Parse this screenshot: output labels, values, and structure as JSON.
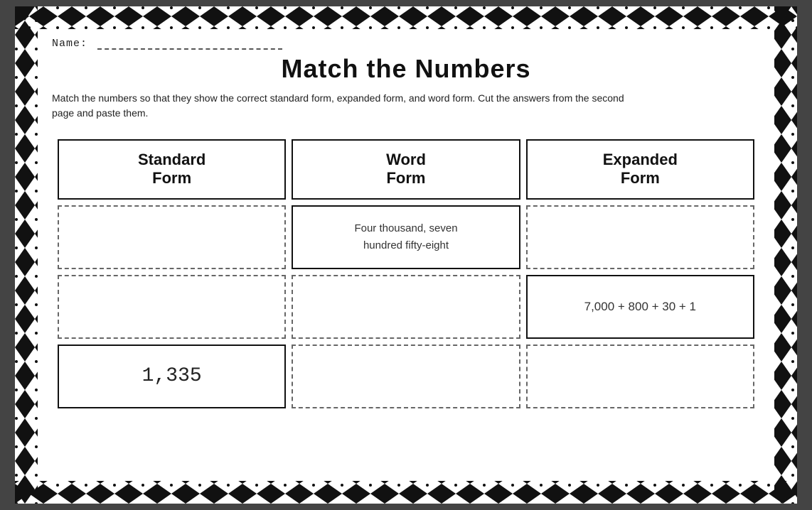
{
  "page": {
    "name_label": "Name:",
    "title": "Match the Numbers",
    "instructions": "Match the numbers so that they show the correct standard form, expanded form, and word form. Cut the answers from the second page and paste them.",
    "columns": [
      {
        "id": "standard",
        "label_line1": "Standard",
        "label_line2": "Form"
      },
      {
        "id": "word",
        "label_line1": "Word",
        "label_line2": "Form"
      },
      {
        "id": "expanded",
        "label_line1": "Expanded",
        "label_line2": "Form"
      }
    ],
    "rows": [
      {
        "standard": {
          "type": "empty",
          "border": "dashed",
          "value": ""
        },
        "word": {
          "type": "text",
          "border": "solid",
          "value": "Four thousand, seven\nhundred fifty-eight"
        },
        "expanded": {
          "type": "empty",
          "border": "dashed",
          "value": ""
        }
      },
      {
        "standard": {
          "type": "empty",
          "border": "dashed",
          "value": ""
        },
        "word": {
          "type": "empty",
          "border": "dashed",
          "value": ""
        },
        "expanded": {
          "type": "math",
          "border": "solid",
          "value": "7,000 + 800 + 30 + 1"
        }
      },
      {
        "standard": {
          "type": "number",
          "border": "solid",
          "value": "1,335"
        },
        "word": {
          "type": "empty",
          "border": "dashed",
          "value": ""
        },
        "expanded": {
          "type": "empty",
          "border": "dashed",
          "value": ""
        }
      }
    ]
  }
}
